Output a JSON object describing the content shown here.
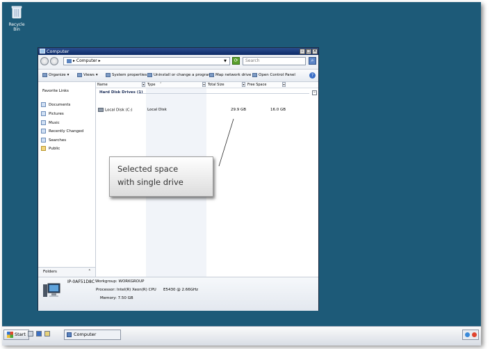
{
  "desktop": {
    "recycle_bin_label": "Recycle Bin"
  },
  "window": {
    "title": "Computer",
    "address": "Computer",
    "search_placeholder": "Search",
    "toolbar": {
      "organize": "Organize",
      "views": "Views",
      "system_properties": "System properties",
      "uninstall": "Uninstall or change a program",
      "map_drive": "Map network drive",
      "control_panel": "Open Control Panel"
    },
    "nav": {
      "heading": "Favorite Links",
      "items": [
        "Documents",
        "Pictures",
        "Music",
        "Recently Changed",
        "Searches",
        "Public"
      ],
      "folders_label": "Folders"
    },
    "columns": {
      "name": "Name",
      "type": "Type",
      "total_size": "Total Size",
      "free_space": "Free Space"
    },
    "group_title": "Hard Disk Drives (1)",
    "drives": [
      {
        "name": "Local Disk (C:)",
        "type": "Local Disk",
        "total_size": "29.9 GB",
        "free_space": "16.0 GB"
      }
    ],
    "details": {
      "computer_name": "IP-0AF51D8C",
      "workgroup": "Workgroup: WORKGROUP",
      "processor_label": "Processor: Intel(R) Xeon(R) CPU",
      "processor_model": "E5430  @ 2.66GHz",
      "memory": "Memory: 7.50 GB"
    }
  },
  "callout": {
    "line1": "Selected space",
    "line2": "with single drive"
  },
  "taskbar": {
    "start_label": "Start",
    "task_label": "Computer"
  }
}
